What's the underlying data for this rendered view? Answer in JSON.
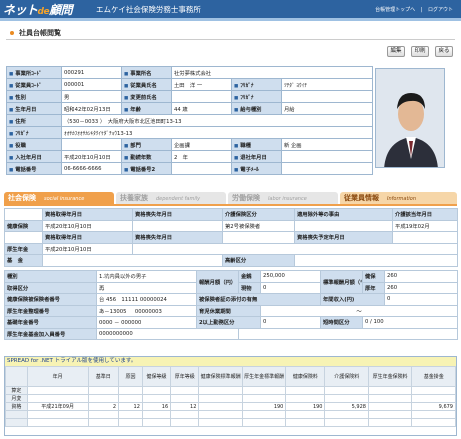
{
  "app": {
    "logo_main": "ネット",
    "logo_mid": "de",
    "logo_tail": "顧問",
    "office": "エムケイ社会保険労務士事務所",
    "links": [
      "台帳管理トップへ",
      "|",
      "ログアウト"
    ]
  },
  "page": {
    "title": "社員台帳閲覧"
  },
  "buttons": {
    "edit": "編集",
    "print": "印刷",
    "back": "戻る"
  },
  "employee": {
    "rows": [
      [
        {
          "l": "事業所ｺｰﾄﾞ",
          "v": "000291"
        },
        {
          "l": "事業所名",
          "v": "社労夢株式会社",
          "span": 3
        }
      ],
      [
        {
          "l": "従業員ｺｰﾄﾞ",
          "v": "000001"
        },
        {
          "l": "従業員氏名",
          "v": "土田　洋 一"
        },
        {
          "l": "ﾌﾘｶﾞﾅ",
          "v": "ﾂﾁﾀﾞ ﾖｳｲﾁ"
        }
      ],
      [
        {
          "l": "性別",
          "v": "男"
        },
        {
          "l": "変更前氏名",
          "v": ""
        },
        {
          "l": "ﾌﾘｶﾞﾅ",
          "v": ""
        }
      ],
      [
        {
          "l": "生年月日",
          "v": "昭和42年02月13日"
        },
        {
          "l": "年齢",
          "v": "44 歳"
        },
        {
          "l": "給与種別",
          "v": "月給"
        }
      ],
      [
        {
          "l": "住所",
          "v": "（530－0033 ）　大阪府大阪市北区池田町13-13",
          "span": 5
        }
      ],
      [
        {
          "l": "ﾌﾘｶﾞﾅ",
          "v": "ｵｵｻｶﾌｵｵｻｶｼｷﾀｸｲｹﾀﾞﾁｮｳ13-13",
          "span": 5
        }
      ],
      [
        {
          "l": "役職",
          "v": ""
        },
        {
          "l": "部門",
          "v": "企画課"
        },
        {
          "l": "職種",
          "v": "新 企画"
        }
      ],
      [
        {
          "l": "入社年月日",
          "v": "平成20年10月10日"
        },
        {
          "l": "勤続年数",
          "v": "2　年"
        },
        {
          "l": "退社年月日",
          "v": ""
        }
      ],
      [
        {
          "l": "電話番号",
          "v": "06-6666-6666"
        },
        {
          "l": "電話番号2",
          "v": ""
        },
        {
          "l": "電子ﾒｰﾙ",
          "v": ""
        }
      ]
    ]
  },
  "tabs": [
    {
      "label": "社会保険",
      "en": "social insurance",
      "bg": "#f0a04b",
      "color": "#ffffff"
    },
    {
      "label": "扶養家族",
      "en": "dependent family",
      "bg": "#e6e6e6",
      "color": "#a0a0a0"
    },
    {
      "label": "労働保険",
      "en": "labor insurance",
      "bg": "#e6e6e6",
      "color": "#a0a0a0"
    },
    {
      "label": "従業員情報",
      "en": "Information",
      "bg": "#f6d6a8",
      "color": "#8a4a10"
    }
  ],
  "insurance": {
    "r1": [
      "資格取得年月日",
      "資格喪失年月日",
      "介護保険区分",
      "適用除外等の事由",
      "介護該当年月日",
      "介護非該当年月"
    ],
    "health_label": "健康保険",
    "health_get": "平成20年10月10日",
    "care_kubun": "第2号被保険者",
    "care_date": "平成19年02月",
    "r3": [
      "資格取得年月日",
      "資格喪失年月日",
      "資格喪失予定年月日"
    ],
    "pension_label": "厚生年金",
    "pension_get": "平成20年10月10日",
    "fund_label": "基　金",
    "elderly": "高齢区分",
    "type_label": "種別",
    "type_val": "1.坑内員以外の男子",
    "pay_label": "報酬月額（円）",
    "money_label": "金銭",
    "money_val": "250,000",
    "std_label": "標準報酬月額（千円）",
    "health_label2": "健保",
    "health_std": "260",
    "acq_label": "取得区分",
    "acq_val": "再",
    "goods_label": "現物",
    "goods_val": "0",
    "pension_label2": "厚年",
    "pension_std": "260",
    "hno_label": "健康保険被保険者番号",
    "hno_val": "台  456　11111 00000024",
    "hcard_label": "被保険者証の添付の有無",
    "hcard_val": "",
    "income_label": "年間収入(円)",
    "income_val": "0",
    "pno_label": "厚生年金整理番号",
    "pno_val": "あ－13005",
    "pno_val2": "00000003",
    "leave_label": "育児休業期間",
    "leave_val": "～",
    "basic_label": "基礎年金番号",
    "basic_val": "0000 － 000000",
    "second_label": "2以上勤務区分",
    "second_val": "0",
    "short_label": "短時間区分",
    "short_val": "0  /  100",
    "kikin_label": "厚生年金基金加入員番号",
    "kikin_val": "0000000000"
  },
  "spread": {
    "banner": "SPREAD for .NET トライアル版を使用しています。",
    "headers": [
      "",
      "年月",
      "基準日",
      "原因",
      "健保等級",
      "厚年等級",
      "健康保険標準報酬",
      "厚生年金標準報酬",
      "健康保険料",
      "介護保険料",
      "厚生年金保険料",
      "基金掛金"
    ],
    "rows": [
      [
        "算定",
        "",
        "",
        "",
        "",
        "",
        "",
        "",
        "",
        "",
        "",
        ""
      ],
      [
        "月変",
        "",
        "",
        "",
        "",
        "",
        "",
        "",
        "",
        "",
        "",
        ""
      ],
      [
        "資格",
        "平成21年09月",
        "2",
        "12",
        "16",
        "12",
        "",
        "190",
        "190",
        "5,928",
        "",
        "9,679"
      ],
      [
        "",
        "",
        "",
        "",
        "",
        "",
        "",
        "",
        "",
        "",
        "",
        ""
      ],
      [
        "",
        "",
        "",
        "",
        "",
        "",
        "",
        "",
        "",
        "",
        "",
        ""
      ]
    ]
  }
}
